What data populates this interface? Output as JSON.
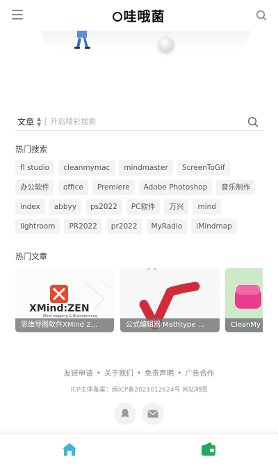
{
  "header": {
    "logo_text": "哇哦菌",
    "menu_icon": "menu-icon",
    "search_icon": "search-icon"
  },
  "search": {
    "type_label": "文章",
    "placeholder": "开启精彩搜索"
  },
  "hot_search": {
    "title": "热门搜索",
    "tags": [
      "fl studio",
      "cleanmymac",
      "mindmaster",
      "ScreenToGif",
      "办公软件",
      "office",
      "Premiere",
      "Adobe Photoshop",
      "音乐制作",
      "index",
      "abbyy",
      "ps2022",
      "PC软件",
      "万兴",
      "mind",
      "lightroom",
      "PR2022",
      "pr2022",
      "MyRadio",
      "iMindmap"
    ]
  },
  "hot_articles": {
    "title": "热门文章",
    "cards": [
      {
        "caption": "思维导图软件XMind 2...",
        "image_text": "XMind:ZEN",
        "image_subtext": "Mind mapping & Brainstorming"
      },
      {
        "caption": "公式编辑器 Mathtype ..."
      },
      {
        "caption": "CleanMy"
      }
    ]
  },
  "footer": {
    "links": [
      "友链申请",
      "关于我们",
      "免责声明",
      "广告合作"
    ],
    "icp": "ICP主体备案：闽ICP备2021012624号 网站地图"
  },
  "colors": {
    "accent_home": "#3fb5d8",
    "accent_app": "#1fae5b",
    "xmind_red": "#e8492c",
    "math_red": "#d32b3c",
    "cleanmy_green": "#cde9c7"
  }
}
